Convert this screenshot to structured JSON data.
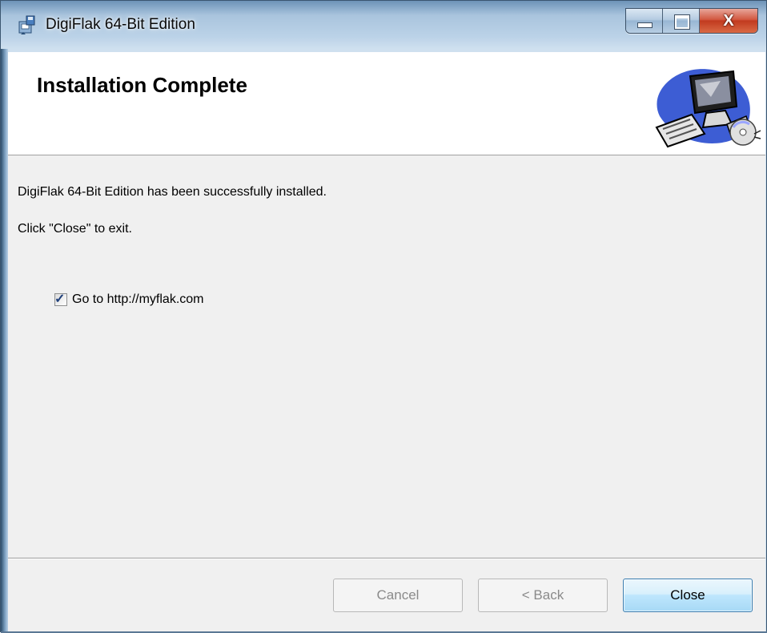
{
  "window": {
    "title": "DigiFlak 64-Bit Edition",
    "caption_buttons": {
      "minimize_icon": "minimize-icon",
      "maximize_icon": "maximize-icon",
      "close_glyph": "X"
    }
  },
  "header": {
    "title": "Installation Complete",
    "art_icon": "computer-with-cd-icon"
  },
  "content": {
    "message_line1": "DigiFlak 64-Bit Edition has been successfully installed.",
    "message_line2": "Click \"Close\" to exit.",
    "checkbox": {
      "label": "Go to http://myflak.com",
      "checked": true
    }
  },
  "footer": {
    "cancel_label": "Cancel",
    "back_label": "< Back",
    "close_label": "Close",
    "cancel_enabled": false,
    "back_enabled": false
  },
  "colors": {
    "titlebar": "#a9c4dd",
    "close_button": "#c13a1f",
    "dialog_background": "#f0f0f0",
    "default_button_border": "#3c7fb1"
  }
}
